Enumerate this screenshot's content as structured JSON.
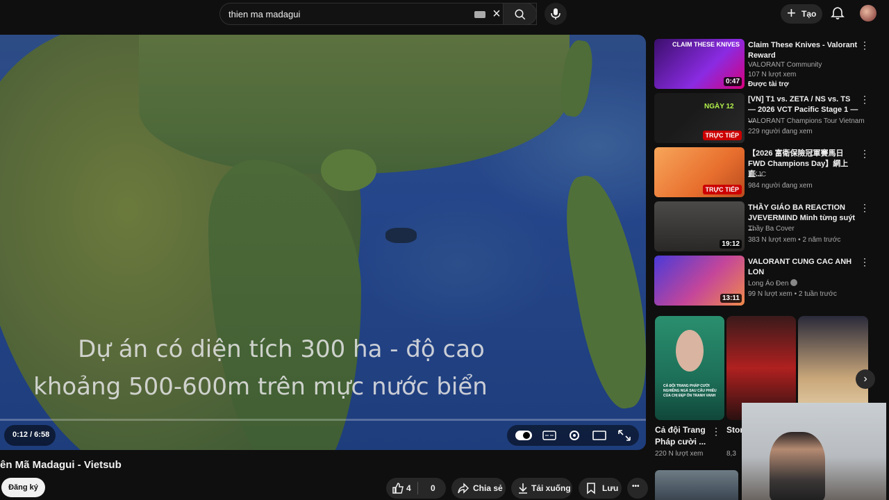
{
  "search": {
    "query": "thien ma madagui"
  },
  "header": {
    "create_label": "Tạo"
  },
  "player": {
    "subtitle_line1": "Dự án có diện tích 300 ha - độ cao",
    "subtitle_line2": "khoảng 500-600m trên mực nước biển",
    "time": "0:12 / 6:58",
    "progress_fraction": 0.029
  },
  "video": {
    "title": "ên Mã Madagui - Vietsub",
    "subscribe_label": "Đăng ký",
    "like_count": "4",
    "dislike_count": "0",
    "share_label": "Chia sẻ",
    "download_label": "Tải xuống",
    "save_label": "Lưu",
    "more_label": "•••"
  },
  "recommendations": [
    {
      "title": "Claim These Knives - Valorant Reward",
      "channel": "VALORANT Community",
      "meta": "107 N lượt xem",
      "badge": "0:47",
      "sponsored": "Được tài trợ",
      "thumb_text": "CLAIM THESE KNIVES"
    },
    {
      "title": "[VN] T1 vs. ZETA / NS vs. TS — 2026 VCT Pacific Stage 1 — ...",
      "channel": "VALORANT Champions Tour Vietnam",
      "meta": "229 người đang xem",
      "badge": "TRỰC TIẾP",
      "thumb_text": "NGÀY 12"
    },
    {
      "title": "【2026 富衛保險冠軍賽馬日 FWD Champions Day】網上直...",
      "channel": "HKJC",
      "meta": "984 người đang xem",
      "badge": "TRỰC TIẾP"
    },
    {
      "title": "THẦY GIÁO BA REACTION JVEVERMIND Minh từng suýt ...",
      "channel": "Thầy Ba Cover",
      "meta": "383 N lượt xem • 2 năm trước",
      "badge": "19:12"
    },
    {
      "title": "VALORANT CUNG CAC ANH LON",
      "channel": "Long Áo Đen",
      "meta": "99 N lượt xem • 2 tuần trước",
      "badge": "13:11"
    }
  ],
  "shorts": [
    {
      "title": "Cả đội Trang Pháp cười ...",
      "meta": "220 N lượt xem",
      "thumb_caption": "CẢ ĐỘI TRANG PHÁP CƯỜI NGHIÊNG NGẢ SAU CÂU PHIẾU CỦA CHỊ ĐẸP ỐN TRANH VANH"
    },
    {
      "title": "Stor wor",
      "meta": "8,3"
    }
  ],
  "icons": {
    "search": "search-icon",
    "mic": "mic-icon",
    "bell": "bell-icon",
    "like": "thumbs-up-icon",
    "dislike": "thumbs-down-icon",
    "share": "share-icon",
    "download": "download-icon",
    "save": "bookmark-icon"
  },
  "colors": {
    "background": "#0f0f0f",
    "live": "#cc0000",
    "chip": "#272727"
  }
}
